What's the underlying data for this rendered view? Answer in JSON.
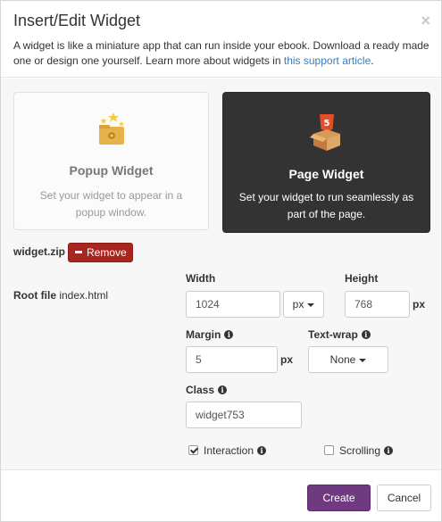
{
  "dialog": {
    "title": "Insert/Edit Widget",
    "close_glyph": "×",
    "description_text": "A widget is like a miniature app that can run inside your ebook. Download a ready made one or design one yourself. Learn more about widgets in ",
    "description_link": "this support article",
    "description_end": "."
  },
  "widget_types": {
    "popup": {
      "title": "Popup Widget",
      "description": "Set your widget to appear in a popup window.",
      "icon": "folder-stars-icon"
    },
    "page": {
      "title": "Page Widget",
      "description": "Set your widget to run seamlessly as part of the page.",
      "icon": "html5-box-icon",
      "selected": true
    }
  },
  "file": {
    "name": "widget.zip",
    "remove_label": "Remove",
    "root_label": "Root file",
    "root_value": "index.html"
  },
  "fields": {
    "width": {
      "label": "Width",
      "value": "1024",
      "unit_select": "px"
    },
    "height": {
      "label": "Height",
      "value": "768",
      "unit": "px"
    },
    "margin": {
      "label": "Margin",
      "value": "5",
      "unit": "px"
    },
    "textwrap": {
      "label": "Text-wrap",
      "value": "None"
    },
    "class": {
      "label": "Class",
      "value": "widget753"
    }
  },
  "options": {
    "interaction": {
      "label": "Interaction",
      "checked": true
    },
    "scrolling": {
      "label": "Scrolling",
      "checked": false
    }
  },
  "footer": {
    "create_label": "Create",
    "cancel_label": "Cancel"
  },
  "colors": {
    "accent": "#6f3a7f",
    "danger": "#a8261f",
    "selected_card": "#333333",
    "link": "#3a7bbf"
  }
}
